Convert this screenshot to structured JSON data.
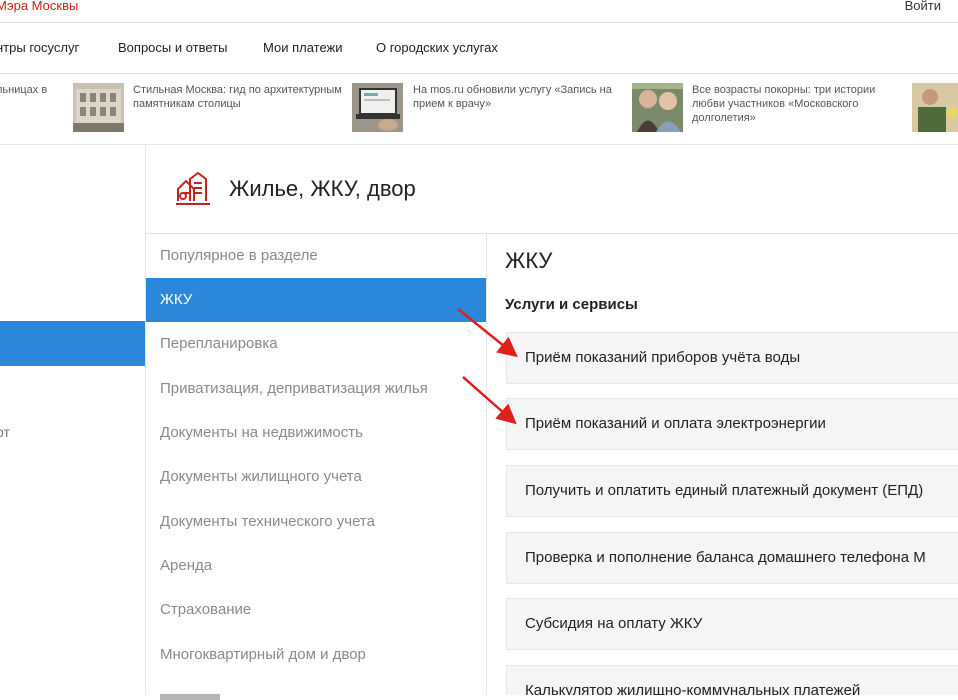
{
  "topbar": {
    "brand": "Мэра Москвы",
    "login": "Войти"
  },
  "nav": {
    "items": [
      "нтры госуслуг",
      "Вопросы и ответы",
      "Мои платежи",
      "О городских услугах"
    ]
  },
  "news": [
    {
      "text": "льницах в"
    },
    {
      "text": "Стильная Москва: гид по архитектурным памятникам столицы"
    },
    {
      "text": "На mos.ru обновили услугу «Запись на прием к врачу»"
    },
    {
      "text": "Все возрасты покорны: три истории любви участников «Московского долголетия»"
    }
  ],
  "left": {
    "partial_text": "рт"
  },
  "section": {
    "title": "Жилье, ЖКУ, двор",
    "icon": "housing-icon"
  },
  "submenu": {
    "items": [
      "Популярное в разделе",
      "ЖКУ",
      "Перепланировка",
      "Приватизация, деприватизация жилья",
      "Документы на недвижимость",
      "Документы жилищного учета",
      "Документы технического учета",
      "Аренда",
      "Страхование",
      "Многоквартирный дом и двор"
    ],
    "active_index": 1
  },
  "content": {
    "heading": "ЖКУ",
    "subheading": "Услуги и сервисы",
    "services": [
      "Приём показаний приборов учёта воды",
      "Приём показаний и оплата электроэнергии",
      "Получить и оплатить единый платежный документ (ЕПД)",
      "Проверка и пополнение баланса домашнего телефона М",
      "Субсидия на оплату ЖКУ",
      "Калькулятор жилищно-коммунальных платежей"
    ]
  },
  "colors": {
    "accent": "#2b87d9",
    "brand": "#c8231e",
    "arrow": "#e0201f"
  }
}
